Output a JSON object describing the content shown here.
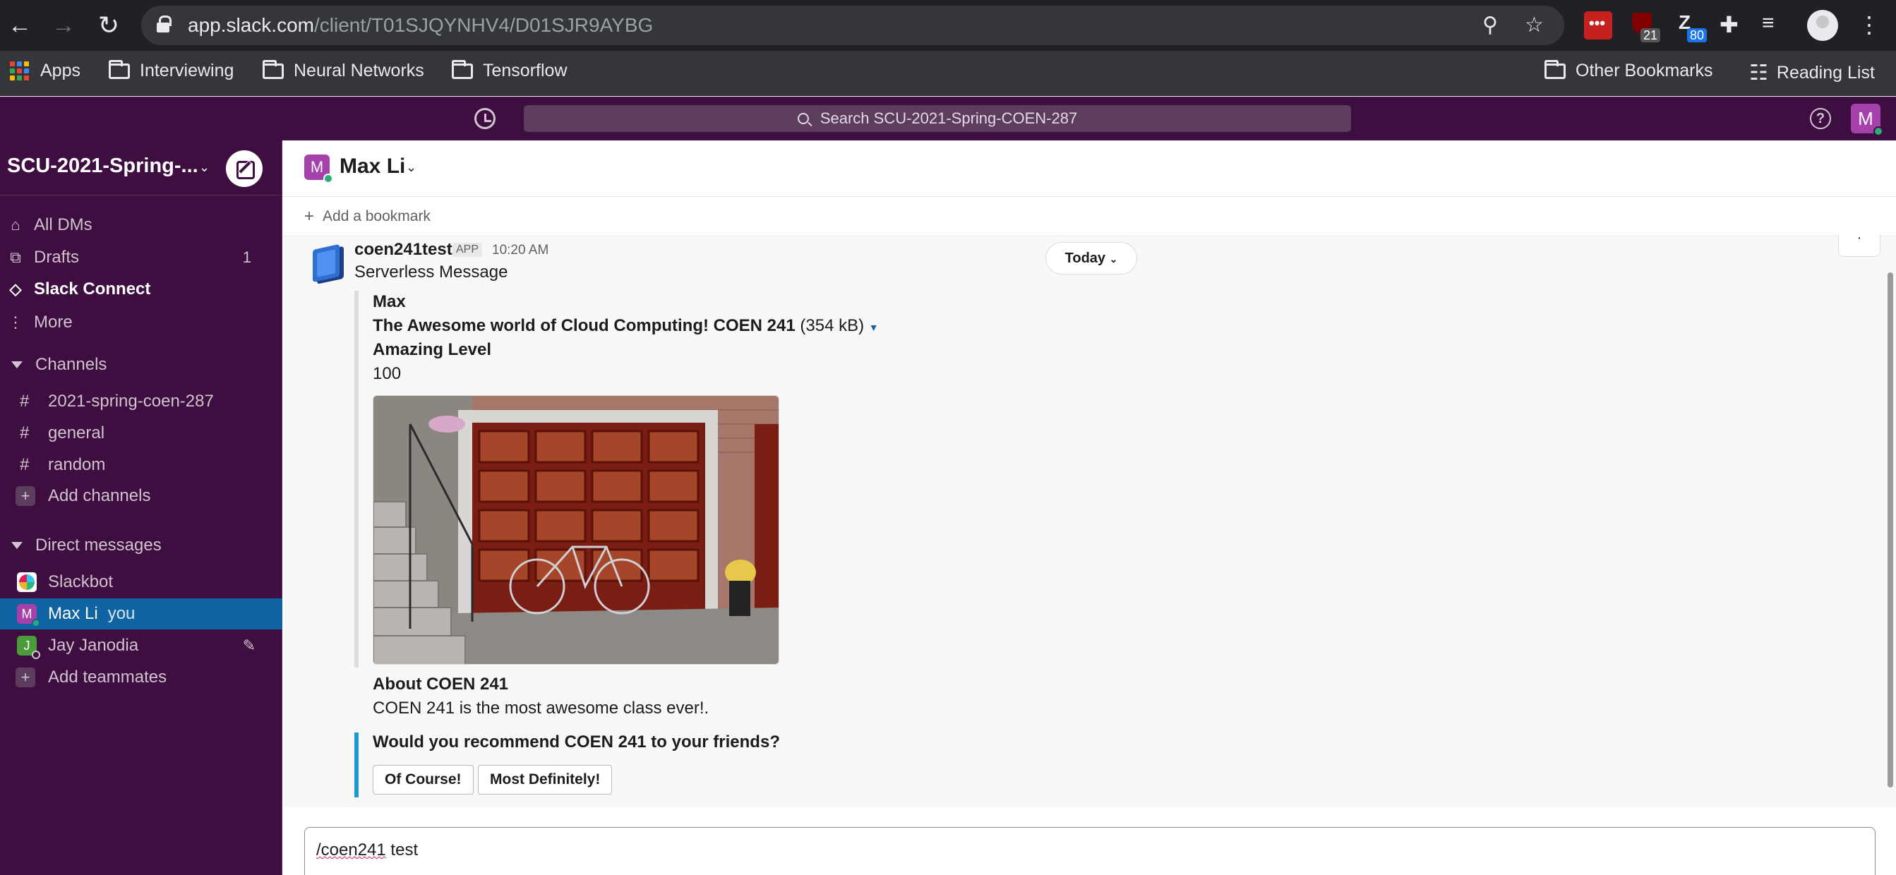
{
  "browser": {
    "url_host": "app.slack.com",
    "url_path": "/client/T01SJQYNHV4/D01SJR9AYBG",
    "extension_badges": [
      "21",
      "80"
    ],
    "bookmarks": {
      "apps": "Apps",
      "items": [
        "Interviewing",
        "Neural Networks",
        "Tensorflow"
      ],
      "other": "Other Bookmarks",
      "reading_list": "Reading List"
    }
  },
  "slack_top": {
    "search_placeholder": "Search SCU-2021-Spring-COEN-287",
    "user_initial": "M",
    "help_glyph": "?"
  },
  "sidebar": {
    "workspace": "SCU-2021-Spring-...",
    "nav": [
      {
        "label": "All DMs"
      },
      {
        "label": "Drafts",
        "badge": "1"
      },
      {
        "label": "Slack Connect"
      },
      {
        "label": "More"
      }
    ],
    "channels_header": "Channels",
    "channels": [
      "2021-spring-coen-287",
      "general",
      "random"
    ],
    "add_channels": "Add channels",
    "dms_header": "Direct messages",
    "dms": [
      {
        "name": "Slackbot"
      },
      {
        "name": "Max Li",
        "suffix": "you",
        "initial": "M"
      },
      {
        "name": "Jay Janodia",
        "initial": "J"
      }
    ],
    "add_teammates": "Add teammates"
  },
  "channel": {
    "name": "Max Li",
    "initial": "M",
    "add_bookmark": "Add a bookmark"
  },
  "message": {
    "sender": "coen241test",
    "tag": "APP",
    "time": "10:20 AM",
    "text": "Serverless Message",
    "date_divider": "Today",
    "attachment": {
      "name": "Max",
      "file_title": "The Awesome world of Cloud Computing! COEN 241",
      "file_size": "(354 kB)",
      "level_label": "Amazing Level",
      "level_value": "100",
      "about_title": "About COEN 241",
      "about_text": "COEN 241 is the most awesome class ever!."
    },
    "question": "Would you recommend COEN 241 to your friends?",
    "buttons": [
      "Of Course!",
      "Most Definitely!"
    ]
  },
  "composer": {
    "command": "/coen241",
    "arg": " test"
  },
  "colors": {
    "sidebar": "#3f0e40",
    "active_item": "#1164a3",
    "accent_blue": "#1d9bd1"
  }
}
